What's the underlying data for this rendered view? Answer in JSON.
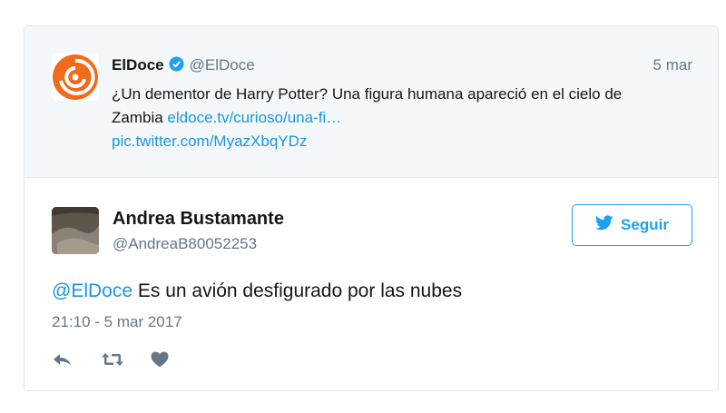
{
  "quoted_tweet": {
    "author_name": "ElDoce",
    "author_handle": "@ElDoce",
    "date": "5 mar",
    "text": "¿Un dementor de Harry Potter? Una figura humana apareció en el cielo de Zambia ",
    "link_text": "eldoce.tv/curioso/una-fi…",
    "pic_link": "pic.twitter.com/MyazXbqYDz",
    "verified_icon": "verified-badge-icon"
  },
  "tweet": {
    "author_name": "Andrea Bustamante",
    "author_handle": "@AndreaB80052253",
    "mention": "@ElDoce",
    "text": " Es un avión desfigurado por las nubes",
    "timestamp": "21:10 - 5 mar 2017"
  },
  "follow_button": {
    "label": "Seguir",
    "icon": "twitter-bird-icon"
  },
  "actions": [
    {
      "name": "reply",
      "icon": "reply-icon"
    },
    {
      "name": "retweet",
      "icon": "retweet-icon"
    },
    {
      "name": "like",
      "icon": "heart-icon"
    }
  ],
  "colors": {
    "link": "#1b95e0",
    "accent": "#1da1f2",
    "muted": "#657786",
    "quoted_bg": "#f5f8fa"
  }
}
